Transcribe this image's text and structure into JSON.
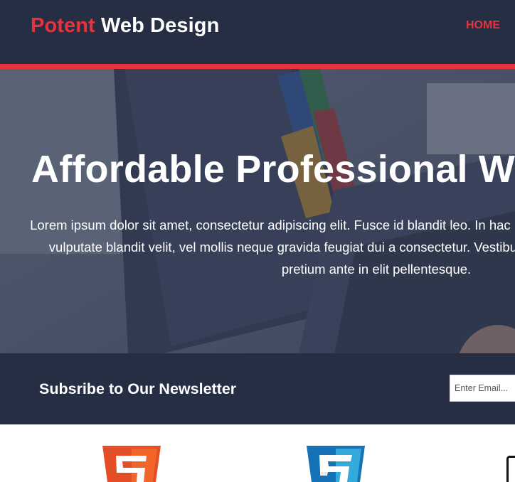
{
  "header": {
    "logo_accent": "Potent",
    "logo_rest": " Web Design",
    "nav": {
      "home": "HOME"
    }
  },
  "hero": {
    "title": "Affordable Professional Web Design",
    "text": "Lorem ipsum dolor sit amet, consectetur adipiscing elit. Fusce id blandit leo. In hac habitasse platea dictumst. Praesent vulputate blandit velit, vel mollis neque gravida feugiat dui a consectetur. Vestibulum luctus libero enim. Donec id pretium ante in elit pellentesque."
  },
  "newsletter": {
    "title": "Subsribe to Our Newsletter",
    "placeholder": "Enter Email..."
  },
  "icons": [
    "html5-icon",
    "css3-icon",
    "device-icon"
  ],
  "colors": {
    "navy": "#262e44",
    "accent": "#e8323f",
    "html5_orange": "#e44d26",
    "css3_blue": "#1572b6"
  }
}
